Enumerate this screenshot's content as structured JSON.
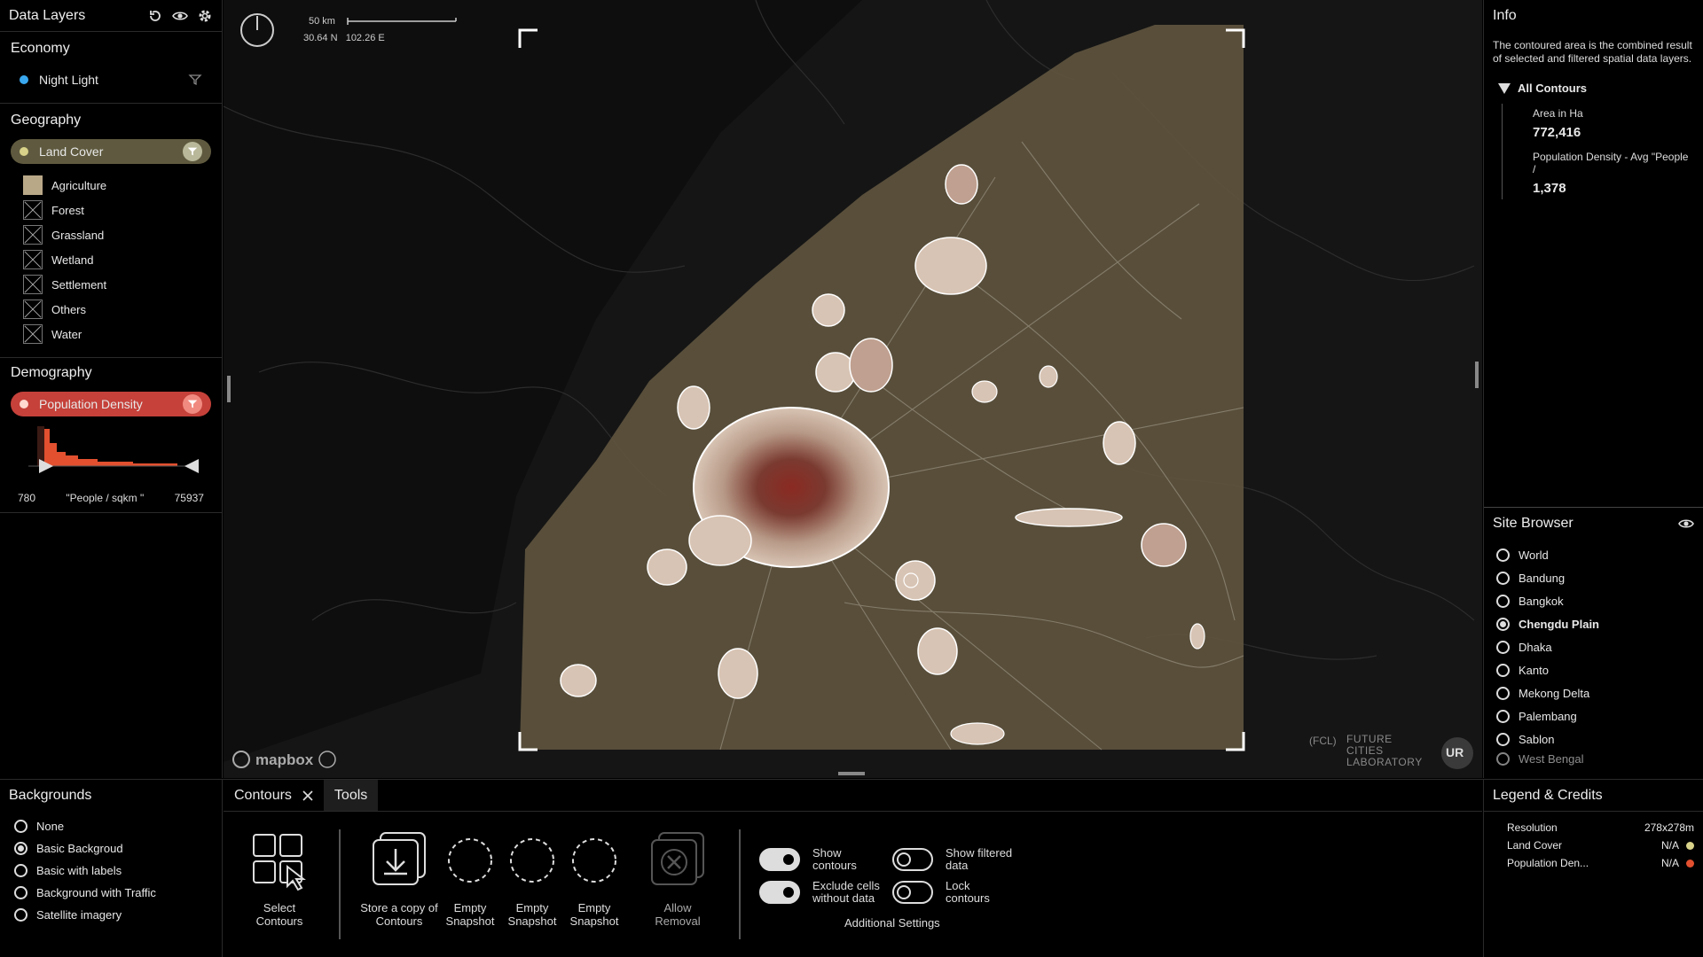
{
  "left": {
    "title": "Data Layers",
    "economy": {
      "heading": "Economy",
      "layer": "Night Light",
      "dot": "#3aa8f0"
    },
    "geography": {
      "heading": "Geography",
      "layer": "Land Cover",
      "dot": "#d9d28a",
      "legend": [
        "Agriculture",
        "Forest",
        "Grassland",
        "Wetland",
        "Settlement",
        "Others",
        "Water"
      ],
      "agri_color": "#b9a888"
    },
    "demography": {
      "heading": "Demography",
      "layer": "Population Density",
      "dot": "#ffd9d0",
      "hist_min": "780",
      "hist_unit": "\"People / sqkm \"",
      "hist_max": "75937",
      "hist_color": "#e2502f"
    }
  },
  "map": {
    "scale_label": "50 km",
    "coords": "30.64 N   102.26 E",
    "attribution": "mapbox",
    "fcl_tag": "(FCL)",
    "fcl_name_1": "FUTURE",
    "fcl_name_2": "CITIES",
    "fcl_name_3": "LABORATORY",
    "urb_logo": "UR",
    "overlay_color": "#5e543e"
  },
  "right": {
    "info_title": "Info",
    "info_text": "The contoured area is the combined result of selected and filtered spatial data layers.",
    "contours_heading": "All Contours",
    "metric1_label": "Area in Ha",
    "metric1_value": "772,416",
    "metric2_label": "Population Density - Avg \"People /",
    "metric2_value": "1,378",
    "site_title": "Site Browser",
    "sites": [
      "World",
      "Bandung",
      "Bangkok",
      "Chengdu Plain",
      "Dhaka",
      "Kanto",
      "Mekong Delta",
      "Palembang",
      "Sablon",
      "West Bengal"
    ],
    "selected_site": "Chengdu Plain"
  },
  "bottom": {
    "bg_title": "Backgrounds",
    "backgrounds": [
      "None",
      "Basic Backgroud",
      "Basic with labels",
      "Background with Traffic",
      "Satellite imagery"
    ],
    "tab_contours": "Contours",
    "tab_tools": "Tools",
    "tool1": "Select Contours",
    "tool2": "Store a copy of Contours",
    "tool3": "Empty Snapshot",
    "tool4": "Empty Snapshot",
    "tool5": "Empty Snapshot",
    "tool6": "Allow Removal",
    "toggle1": "Show contours",
    "toggle2": "Exclude cells without data",
    "toggle3": "Show filtered data",
    "toggle4": "Lock contours",
    "additional": "Additional Settings",
    "legend_title": "Legend & Credits",
    "legend_rows": [
      {
        "label": "Resolution",
        "value": "278x278m",
        "color": ""
      },
      {
        "label": "Land Cover",
        "value": "N/A",
        "color": "#d9d28a"
      },
      {
        "label": "Population Den...",
        "value": "N/A",
        "color": "#e2502f"
      }
    ]
  }
}
